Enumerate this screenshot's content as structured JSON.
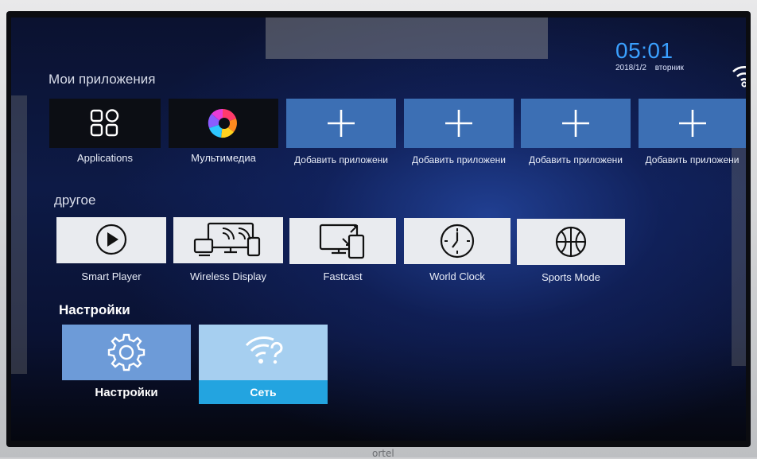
{
  "clock": {
    "time": "05:01",
    "date": "2018/1/2",
    "weekday": "вторник"
  },
  "sections": {
    "my_apps": "Мои приложения",
    "other": "другое",
    "settings": "Настройки"
  },
  "my_apps": [
    {
      "label": "Applications",
      "icon": "apps-grid-icon"
    },
    {
      "label": "Мультимедиа",
      "icon": "multimedia-icon"
    },
    {
      "label": "Добавить приложени",
      "icon": "plus-icon"
    },
    {
      "label": "Добавить приложени",
      "icon": "plus-icon"
    },
    {
      "label": "Добавить приложени",
      "icon": "plus-icon"
    },
    {
      "label": "Добавить приложени",
      "icon": "plus-icon"
    }
  ],
  "other_apps": [
    {
      "label": "Smart Player",
      "icon": "play-icon"
    },
    {
      "label": "Wireless Display",
      "icon": "wireless-display-icon"
    },
    {
      "label": "Fastcast",
      "icon": "fastcast-icon"
    },
    {
      "label": "World Clock",
      "icon": "clock-icon"
    },
    {
      "label": "Sports Mode",
      "icon": "basketball-icon"
    }
  ],
  "settings_tiles": [
    {
      "label": "Настройки",
      "icon": "gear-icon"
    },
    {
      "label": "Сеть",
      "icon": "wifi-question-icon"
    }
  ],
  "brand_text": "ortel",
  "colors": {
    "accent": "#3aa0ff",
    "selected_label": "#23a4e0"
  }
}
